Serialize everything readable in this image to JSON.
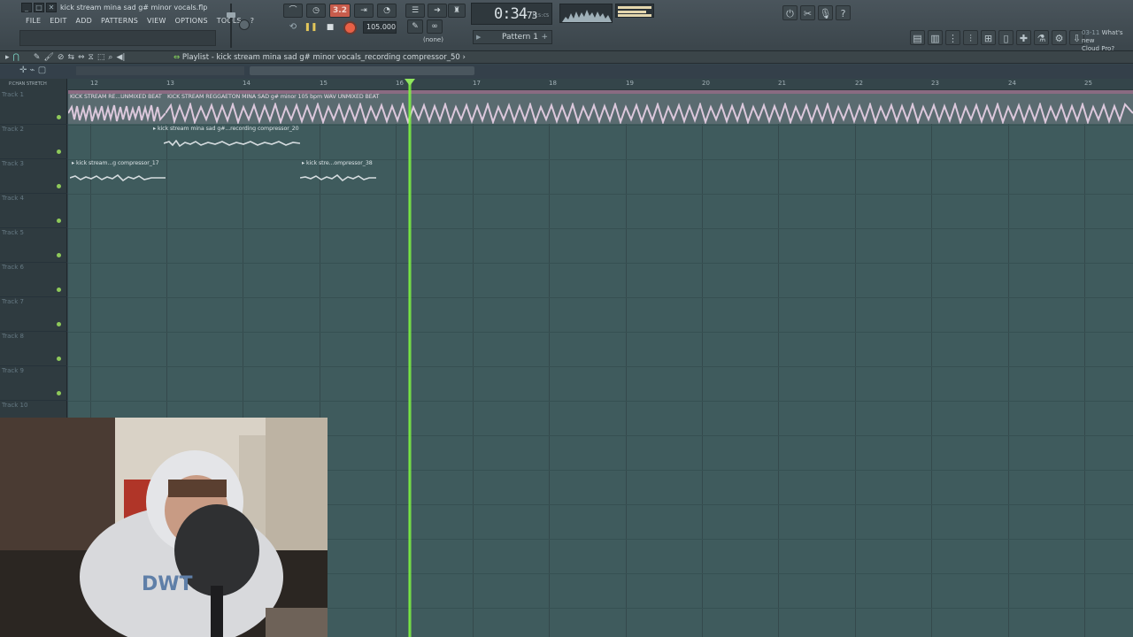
{
  "app": {
    "window_title": "kick stream mina sad g# minor vocals.flp",
    "window_buttons": [
      "_",
      "□",
      "✕"
    ],
    "menu": [
      "FILE",
      "EDIT",
      "ADD",
      "PATTERNS",
      "VIEW",
      "OPTIONS",
      "TOOLS",
      "?"
    ]
  },
  "transport": {
    "time": "0:34",
    "time_fraction": "73",
    "time_unit": "M:S:CS",
    "tempo": "105.000",
    "song_mode_label": "3.2",
    "pattern_label": "Pattern 1",
    "pattern_add": "+",
    "snap": "(none)"
  },
  "news": {
    "date": "03-11",
    "line1": "What's new",
    "line2": "Cloud Pro?"
  },
  "playlist": {
    "title": "Playlist - kick stream mina sad g# minor vocals_recording compressor_50",
    "picker_label": "P.CHAN STRETCH",
    "ruler": [
      "12",
      "13",
      "14",
      "15",
      "16",
      "17",
      "18",
      "19",
      "20",
      "21",
      "22",
      "23",
      "24",
      "25"
    ],
    "tracks": [
      "Track 1",
      "Track 2",
      "Track 3",
      "Track 4",
      "Track 5",
      "Track 6",
      "Track 7",
      "Track 8",
      "Track 9",
      "Track 10"
    ],
    "clips": [
      {
        "track": 1,
        "name": "KICK STREAM RE...UNMIXED BEAT"
      },
      {
        "track": 1,
        "name": "KICK STREAM REGGAETON MINA SAD g# minor 105 bpm WAV UNMIXED BEAT"
      },
      {
        "track": 2,
        "name": "kick stream mina sad g#...recording compressor_20"
      },
      {
        "track": 3,
        "name": "kick stream...g compressor_17"
      },
      {
        "track": 3,
        "name": "kick stre...ompressor_38"
      }
    ]
  },
  "colors": {
    "playhead": "#7dff3a",
    "record": "#e86046",
    "audio_clip_header": "#8a6b82",
    "grid_bg": "#3f5b5d"
  }
}
